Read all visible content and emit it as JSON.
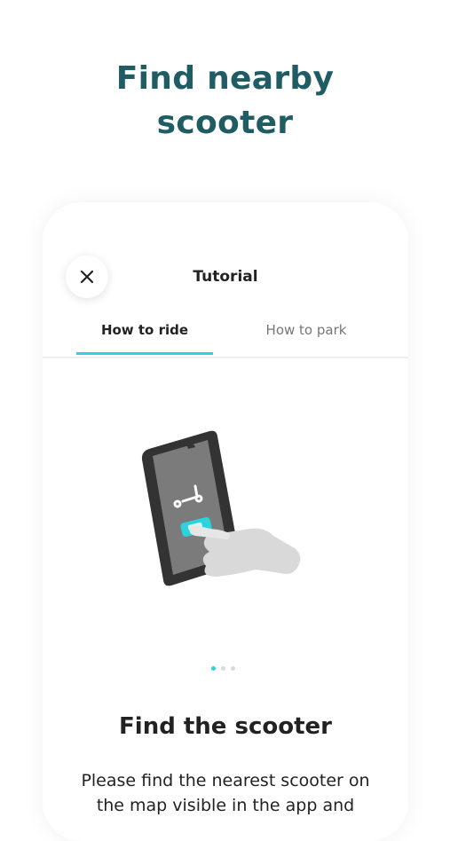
{
  "headline": {
    "line1": "Find nearby",
    "line2": "scooter"
  },
  "modal": {
    "title": "Tutorial",
    "close_icon": "close-icon",
    "tabs": [
      {
        "label": "How to ride",
        "active": true
      },
      {
        "label": "How to park",
        "active": false
      }
    ],
    "step": {
      "title": "Find the scooter",
      "description": "Please find the nearest scooter on the map visible in the app and"
    },
    "pagination": {
      "total": 3,
      "current": 1
    }
  },
  "colors": {
    "accent": "#2bd3dc",
    "headline": "#1f5c63",
    "text": "#222222"
  }
}
